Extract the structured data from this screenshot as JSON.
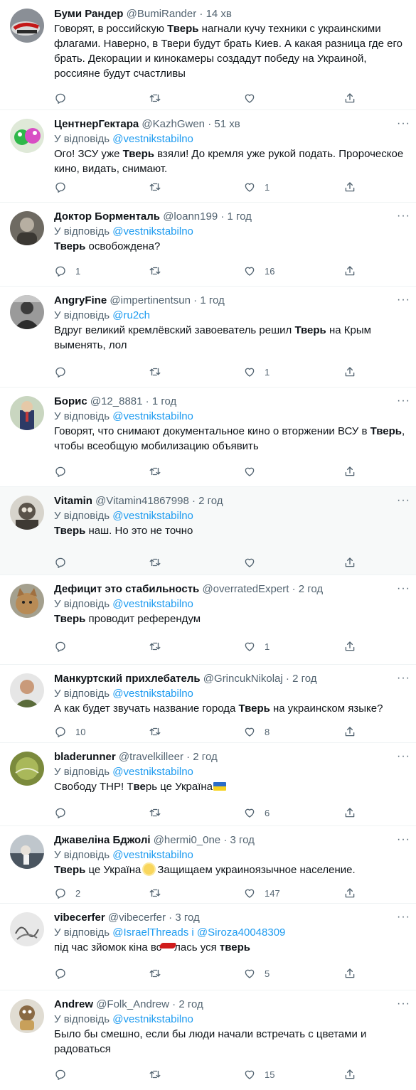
{
  "colors": {
    "accent": "#1d9bf0",
    "muted": "#536471",
    "text": "#0f1419",
    "flag_blue": "#2a6cc8",
    "flag_yellow": "#f6d11c"
  },
  "icons": {
    "reply": "reply-icon",
    "retweet": "retweet-icon",
    "like": "like-icon",
    "share": "share-icon",
    "more": "more-icon"
  },
  "reply_prefix": "У відповідь",
  "tweets": [
    {
      "name": "Буми Рандер",
      "handle": "@BumiRander",
      "time": "14 хв",
      "text": [
        "Говорят, в российскую ",
        "Тверь",
        " нагнали кучу техники с украинскими флагами. Наверно, в Твери будут брать Киев. А какая разница где его брать. Декорации и кинокамеры создадут победу на Украиной, россияне будут счастливы"
      ],
      "replies": "",
      "likes": ""
    },
    {
      "name": "ЦентнерГектара",
      "handle": "@KazhGwen",
      "time": "51 хв",
      "mention": "@vestnikstabilno",
      "text": [
        "Ого! ЗСУ уже ",
        "Тверь",
        " взяли! До кремля уже рукой подать. Пророческое кино, видать, снимают."
      ],
      "replies": "",
      "likes": "1"
    },
    {
      "name": "Доктор Борменталь",
      "handle": "@loann199",
      "time": "1 год",
      "mention": "@vestnikstabilno",
      "text": [
        "",
        "Тверь",
        " освобождена?"
      ],
      "replies": "1",
      "likes": "16"
    },
    {
      "name": "AngryFine",
      "handle": "@impertinentsun",
      "time": "1 год",
      "mention": "@ru2ch",
      "text": [
        "Вдруг великий кремлёвский завоеватель решил ",
        "Тверь",
        " на Крым выменять, лол"
      ],
      "replies": "",
      "likes": "1"
    },
    {
      "name": "Борис",
      "handle": "@12_8881",
      "time": "1 год",
      "mention": "@vestnikstabilno",
      "text": [
        "Говорят, что снимают документальное кино о вторжении ВСУ в ",
        "Тверь",
        ", чтобы всеобщую мобилизацию объявить"
      ],
      "replies": "",
      "likes": ""
    },
    {
      "name": "Vitamin",
      "handle": "@Vitamin41867998",
      "time": "2 год",
      "mention": "@vestnikstabilno",
      "text": [
        "",
        "Тверь",
        " наш. Но это не точно"
      ],
      "replies": "",
      "likes": ""
    },
    {
      "name": "Дефицит это стабильность",
      "handle": "@overratedExpert",
      "time": "2 год",
      "mention": "@vestnikstabilno",
      "text": [
        "",
        "Тверь",
        " проводит референдум"
      ],
      "replies": "",
      "likes": "1"
    },
    {
      "name": "Манкуртский прихлебатель",
      "handle": "@GrincukNikolaj",
      "time": "2 год",
      "mention": "@vestnikstabilno",
      "text": [
        "А как будет звучать название города ",
        "Тверь",
        " на украинском языке?"
      ],
      "replies": "10",
      "likes": "8"
    },
    {
      "name": "bladerunner",
      "handle": "@travelkilleer",
      "time": "2 год",
      "mention": "@vestnikstabilno",
      "text": [
        "Свободу ТНР! Т",
        "ве",
        "рь це Україна"
      ],
      "replies": "",
      "likes": "6"
    },
    {
      "name": "Джавеліна Бджолі",
      "handle": "@hermi0_0ne",
      "time": "3 год",
      "mention": "@vestnikstabilno",
      "text": [
        "",
        "Тверь",
        " це Україна",
        "Защищаем украиноязычное население."
      ],
      "replies": "2",
      "likes": "147"
    },
    {
      "name": "vibecerfer",
      "handle": "@vibecerfer",
      "time": "3 год",
      "mention": "@IsraelThreads",
      "mention_join": "і",
      "mention2": "@Siroza40048309",
      "text": [
        "під час зйомок кіна вс",
        "лась уся ",
        "тверь"
      ],
      "replies": "",
      "likes": "5"
    },
    {
      "name": "Andrew",
      "handle": "@Folk_Andrew",
      "time": "2 год",
      "mention": "@vestnikstabilno",
      "text": [
        "Было бы смешно, если бы люди начали встречать с цветами и радоваться"
      ],
      "replies": "",
      "likes": "15"
    }
  ]
}
